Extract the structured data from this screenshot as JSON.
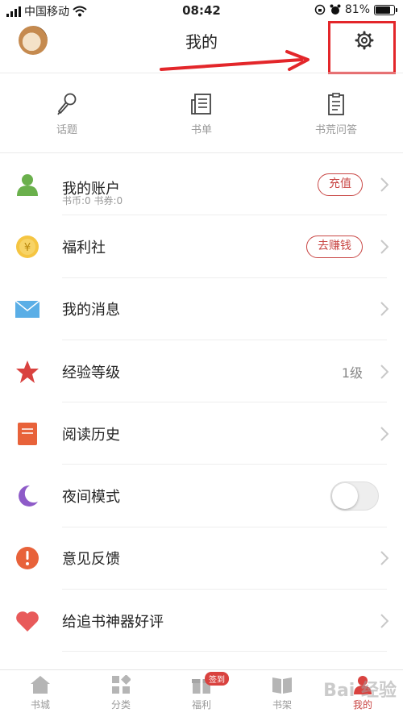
{
  "status_bar": {
    "carrier": "中国移动",
    "time": "08:42",
    "battery": "81%",
    "battery_level": 0.81
  },
  "header": {
    "title": "我的"
  },
  "shortcuts": [
    {
      "label": "话题",
      "icon": "microphone-icon"
    },
    {
      "label": "书单",
      "icon": "document-list-icon"
    },
    {
      "label": "书荒问答",
      "icon": "clipboard-icon"
    }
  ],
  "menu": {
    "account": {
      "label": "我的账户",
      "sub": "书币:0   书券:0",
      "action": "充值",
      "icon": "user-icon",
      "color": "#6ab04c"
    },
    "welfare": {
      "label": "福利社",
      "action": "去赚钱",
      "icon": "coin-icon",
      "color": "#f5c542"
    },
    "messages": {
      "label": "我的消息",
      "icon": "envelope-icon",
      "color": "#5aaee6"
    },
    "level": {
      "label": "经验等级",
      "value": "1级",
      "icon": "star-icon",
      "color": "#d9423f"
    },
    "history": {
      "label": "阅读历史",
      "icon": "book-icon",
      "color": "#e8623a"
    },
    "night": {
      "label": "夜间模式",
      "enabled": false,
      "icon": "moon-icon",
      "color": "#8e5bc8"
    },
    "feedback": {
      "label": "意见反馈",
      "icon": "alert-icon",
      "color": "#e8623a"
    },
    "rate": {
      "label": "给追书神器好评",
      "icon": "heart-icon",
      "color": "#e85a5a"
    }
  },
  "tabbar": {
    "tabs": [
      {
        "label": "书城",
        "icon": "home-icon"
      },
      {
        "label": "分类",
        "icon": "grid-icon"
      },
      {
        "label": "福利",
        "icon": "gift-icon",
        "badge": "签到"
      },
      {
        "label": "书架",
        "icon": "bookshelf-icon"
      },
      {
        "label": "我的",
        "icon": "profile-icon",
        "active": true
      }
    ]
  },
  "watermark": "Bai 经验",
  "colors": {
    "accent": "#c94745",
    "highlight": "#e3262a"
  }
}
